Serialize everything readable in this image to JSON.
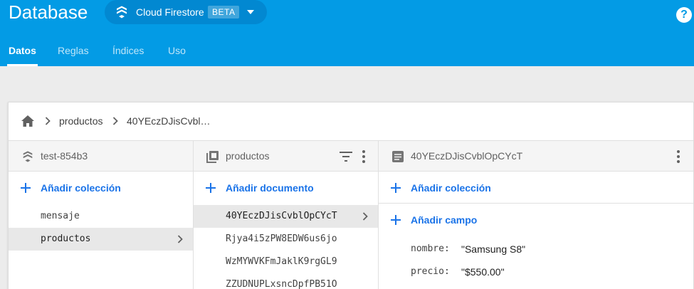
{
  "header": {
    "title": "Database",
    "product": {
      "name": "Cloud Firestore",
      "badge": "BETA"
    },
    "help_icon": "help-icon",
    "tabs": [
      {
        "label": "Datos",
        "active": true
      },
      {
        "label": "Reglas",
        "active": false
      },
      {
        "label": "Índices",
        "active": false
      },
      {
        "label": "Uso",
        "active": false
      }
    ],
    "colors": {
      "header_bg": "#039be5",
      "accent": "#1a73e8"
    }
  },
  "breadcrumb": {
    "home_icon": "home-icon",
    "items": [
      "productos",
      "40YEczDJisCvbl…"
    ]
  },
  "columns": {
    "root": {
      "header": "test-854b3",
      "add_label": "Añadir colección",
      "items": [
        {
          "label": "mensaje",
          "selected": false
        },
        {
          "label": "productos",
          "selected": true
        }
      ]
    },
    "collection": {
      "header": "productos",
      "add_label": "Añadir documento",
      "items": [
        {
          "label": "40YEczDJisCvblOpCYcT",
          "selected": true
        },
        {
          "label": "Rjya4i5zPW8EDW6us6jo",
          "selected": false
        },
        {
          "label": "WzMYWVKFmJaklK9rgGL9",
          "selected": false
        },
        {
          "label": "ZZUDNUPLxsncDpfPB51O",
          "selected": false
        }
      ]
    },
    "document": {
      "header": "40YEczDJisCvblOpCYcT",
      "add_collection_label": "Añadir colección",
      "add_field_label": "Añadir campo",
      "fields": [
        {
          "key": "nombre:",
          "value": "\"Samsung S8\""
        },
        {
          "key": "precio:",
          "value": "\"$550.00\""
        }
      ]
    }
  }
}
